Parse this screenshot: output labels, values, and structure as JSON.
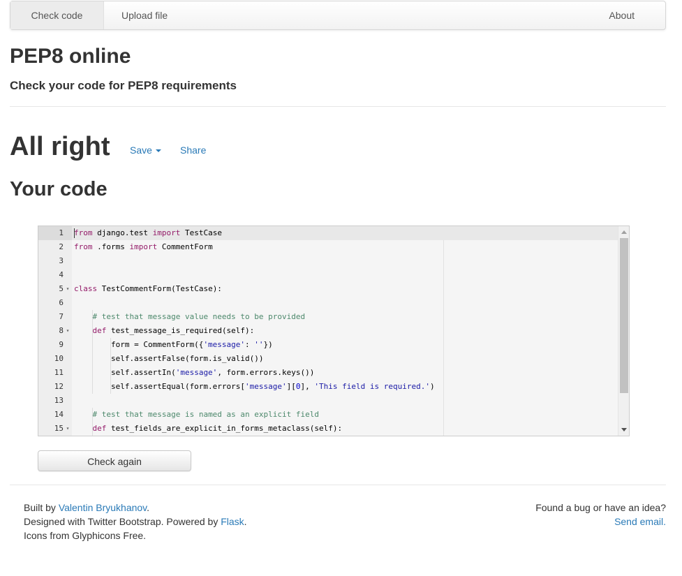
{
  "nav": {
    "check_code": "Check code",
    "upload_file": "Upload file",
    "about": "About"
  },
  "header": {
    "title": "PEP8 online",
    "subtitle": "Check your code for PEP8 requirements"
  },
  "result": {
    "status": "All right",
    "save_label": "Save",
    "share_label": "Share"
  },
  "code_section": {
    "heading": "Your code",
    "lines": [
      {
        "number": "1",
        "fold": false,
        "indent": 0
      },
      {
        "number": "2",
        "fold": false,
        "indent": 0
      },
      {
        "number": "3",
        "fold": false,
        "indent": 0
      },
      {
        "number": "4",
        "fold": false,
        "indent": 0
      },
      {
        "number": "5",
        "fold": true,
        "indent": 0
      },
      {
        "number": "6",
        "fold": false,
        "indent": 0
      },
      {
        "number": "7",
        "fold": false,
        "indent": 1
      },
      {
        "number": "8",
        "fold": true,
        "indent": 1
      },
      {
        "number": "9",
        "fold": false,
        "indent": 2
      },
      {
        "number": "10",
        "fold": false,
        "indent": 2
      },
      {
        "number": "11",
        "fold": false,
        "indent": 2
      },
      {
        "number": "12",
        "fold": false,
        "indent": 2
      },
      {
        "number": "13",
        "fold": false,
        "indent": 0
      },
      {
        "number": "14",
        "fold": false,
        "indent": 1
      },
      {
        "number": "15",
        "fold": true,
        "indent": 1
      }
    ],
    "tokens": [
      [
        [
          "kw",
          "from"
        ],
        [
          "t",
          " django.test "
        ],
        [
          "kw",
          "import"
        ],
        [
          "t",
          " TestCase"
        ]
      ],
      [
        [
          "kw",
          "from"
        ],
        [
          "t",
          " .forms "
        ],
        [
          "kw",
          "import"
        ],
        [
          "t",
          " CommentForm"
        ]
      ],
      [],
      [],
      [
        [
          "kw",
          "class"
        ],
        [
          "t",
          " TestCommentForm(TestCase):"
        ]
      ],
      [],
      [
        [
          "t",
          "    "
        ],
        [
          "cm",
          "# test that message value needs to be provided"
        ]
      ],
      [
        [
          "t",
          "    "
        ],
        [
          "kw",
          "def"
        ],
        [
          "t",
          " test_message_is_required(self):"
        ]
      ],
      [
        [
          "t",
          "        form = CommentForm({"
        ],
        [
          "st",
          "'message'"
        ],
        [
          "t",
          ": "
        ],
        [
          "st",
          "''"
        ],
        [
          "t",
          "})"
        ]
      ],
      [
        [
          "t",
          "        self.assertFalse(form.is_valid())"
        ]
      ],
      [
        [
          "t",
          "        self.assertIn("
        ],
        [
          "st",
          "'message'"
        ],
        [
          "t",
          ", form.errors.keys())"
        ]
      ],
      [
        [
          "t",
          "        self.assertEqual(form.errors["
        ],
        [
          "st",
          "'message'"
        ],
        [
          "t",
          "]["
        ],
        [
          "num",
          "0"
        ],
        [
          "t",
          "], "
        ],
        [
          "st",
          "'This field is required.'"
        ],
        [
          "t",
          ")"
        ]
      ],
      [],
      [
        [
          "t",
          "    "
        ],
        [
          "cm",
          "# test that message is named as an explicit field"
        ]
      ],
      [
        [
          "t",
          "    "
        ],
        [
          "kw",
          "def"
        ],
        [
          "t",
          " test_fields_are_explicit_in_forms_metaclass(self):"
        ]
      ]
    ],
    "colors": {
      "kw": "#931a68",
      "cm": "#4c886b",
      "st": "#1a1aa6",
      "num": "#0000cd",
      "t": "#000000"
    }
  },
  "actions": {
    "check_again": "Check again"
  },
  "footer": {
    "built_by_prefix": "Built by ",
    "author": "Valentin Bryukhanov",
    "built_by_suffix": ".",
    "designed_prefix": "Designed with Twitter Bootstrap. Powered by ",
    "flask": "Flask",
    "designed_suffix": ".",
    "icons_note": "Icons from Glyphicons Free.",
    "bug_prompt": "Found a bug or have an idea?",
    "send_email": "Send email",
    "send_email_suffix": "."
  }
}
